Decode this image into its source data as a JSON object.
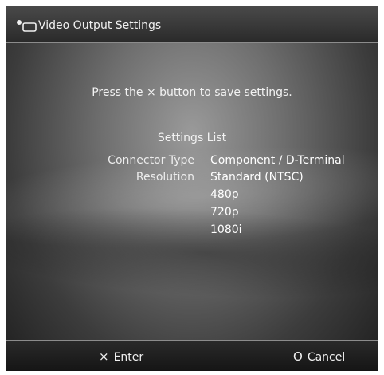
{
  "header": {
    "title": "Video Output Settings",
    "icon": "ps-controller-icon"
  },
  "message": "Press the × button to save settings.",
  "settings": {
    "title": "Settings List",
    "connector_label": "Connector Type",
    "connector_value": "Component / D-Terminal",
    "resolution_label": "Resolution",
    "resolutions": [
      "Standard (NTSC)",
      "480p",
      "720p",
      "1080i"
    ]
  },
  "footer": {
    "enter_symbol": "×",
    "enter_label": "Enter",
    "cancel_symbol": "O",
    "cancel_label": "Cancel"
  }
}
